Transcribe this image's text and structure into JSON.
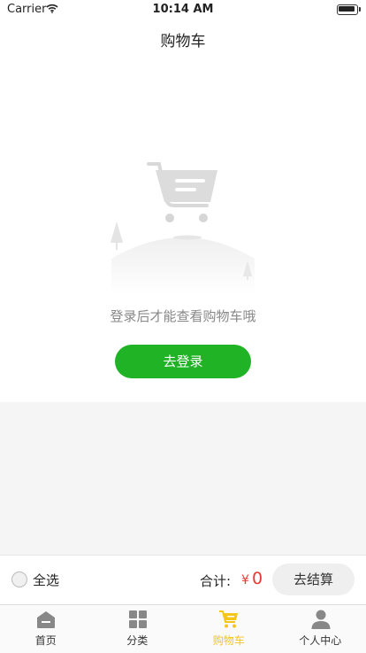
{
  "status_bar": {
    "carrier": "Carrier",
    "time": "10:14 AM"
  },
  "nav": {
    "title": "购物车"
  },
  "empty_state": {
    "message": "登录后才能查看购物车哦",
    "login_button": "去登录"
  },
  "checkout": {
    "select_all": "全选",
    "total_label": "合计:",
    "currency": "¥",
    "amount": "0",
    "checkout_button": "去结算"
  },
  "tabs": [
    {
      "label": "首页",
      "icon": "home-icon"
    },
    {
      "label": "分类",
      "icon": "category-icon"
    },
    {
      "label": "购物车",
      "icon": "cart-icon",
      "active": true
    },
    {
      "label": "个人中心",
      "icon": "user-icon"
    }
  ],
  "colors": {
    "primary_green": "#1fb325",
    "price_red": "#e53935",
    "active_tab": "#f5c518"
  }
}
